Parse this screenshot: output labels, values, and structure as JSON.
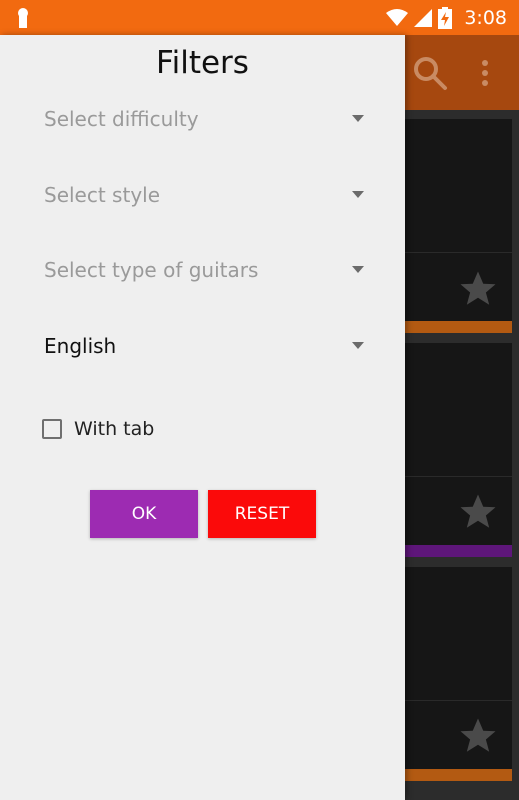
{
  "status_bar": {
    "time": "3:08",
    "icons": [
      "app-notification-icon",
      "wifi-icon",
      "signal-icon",
      "battery-charging-icon"
    ]
  },
  "background_app": {
    "toolbar_icons": [
      "search-icon",
      "more-vert-icon"
    ],
    "card_strip_colors": [
      "#b35a12",
      "#5e167a",
      "#b35a12"
    ]
  },
  "drawer": {
    "title": "Filters",
    "dropdowns": [
      {
        "label": "Select difficulty",
        "selected": false
      },
      {
        "label": "Select style",
        "selected": false
      },
      {
        "label": "Select type of guitars",
        "selected": false
      },
      {
        "label": "English",
        "selected": true
      }
    ],
    "checkbox": {
      "label": "With tab",
      "checked": false
    },
    "buttons": {
      "ok_label": "OK",
      "reset_label": "RESET"
    }
  },
  "colors": {
    "status_bar": "#f26a10",
    "toolbar": "#a6480f",
    "drawer_bg": "#efefef",
    "ok_button": "#9d2bb2",
    "reset_button": "#fb0a0a"
  }
}
